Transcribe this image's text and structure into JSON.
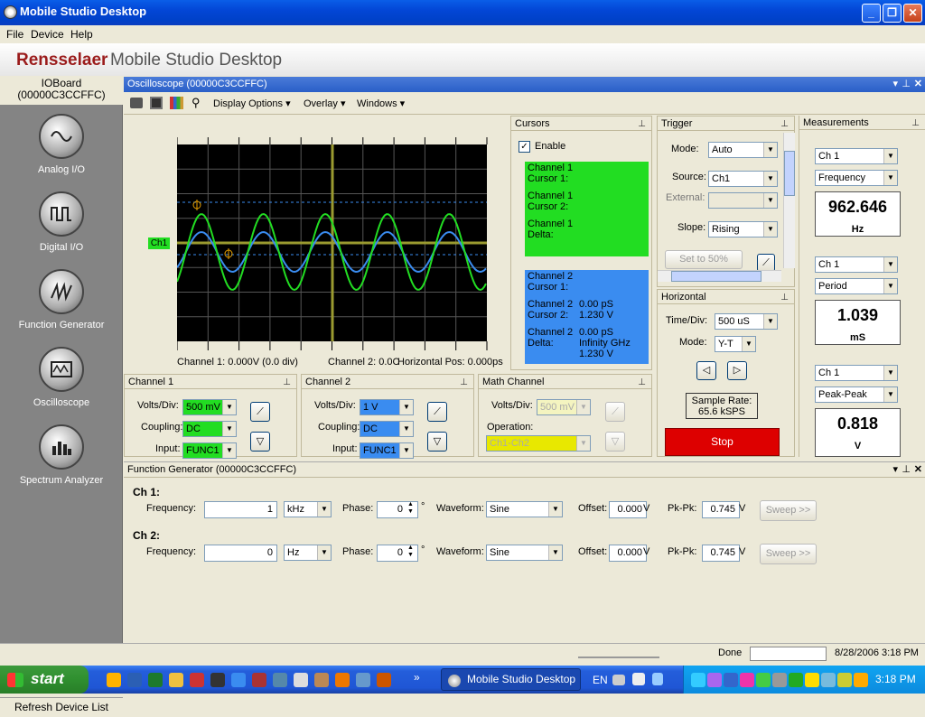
{
  "window": {
    "title": "Mobile Studio Desktop",
    "minimize": "_",
    "maximize": "❐",
    "close": "✕"
  },
  "menu": [
    "File",
    "Device",
    "Help"
  ],
  "banner": {
    "brand": "Rensselaer",
    "product": "Mobile Studio Desktop"
  },
  "sidebar": {
    "board": "IOBoard (00000C3CCFFC)",
    "items": [
      {
        "label": "Analog I/O",
        "icon": "sine-wave-icon"
      },
      {
        "label": "Digital I/O",
        "icon": "square-wave-icon"
      },
      {
        "label": "Function Generator",
        "icon": "sawtooth-icon"
      },
      {
        "label": "Oscilloscope",
        "icon": "oscilloscope-icon"
      },
      {
        "label": "Spectrum Analyzer",
        "icon": "spectrum-icon"
      }
    ],
    "refresh": "Refresh Device List"
  },
  "oscilloscope": {
    "title": "Oscilloscope (00000C3CCFFC)",
    "toolbar": [
      "Display Options",
      "Overlay",
      "Windows"
    ],
    "ch1_marker": "Ch1",
    "status_ch1": "Channel 1: 0.000V (0.0 div)",
    "status_ch2": "Channel 2: 0.0C",
    "status_hpos": "Horizontal Pos: 0.000ps",
    "cursors": {
      "title": "Cursors",
      "enable": "Enable",
      "check": "✓",
      "ch1": [
        "Channel 1",
        "Cursor 1:",
        "Channel 1",
        "Cursor 2:",
        "Channel 1",
        "Delta:"
      ],
      "ch2": {
        "c1a": "Channel 2",
        "c1b": "Cursor 1:",
        "c2a": "Channel 2",
        "c2b": "Cursor 2:",
        "c2v1": "0.00 pS",
        "c2v2": "1.230 V",
        "da": "Channel 2",
        "db": "Delta:",
        "dv1": "0.00 pS",
        "dv2": "Infinity GHz",
        "dv3": "1.230 V"
      }
    },
    "trigger": {
      "title": "Trigger",
      "mode_label": "Mode:",
      "mode": "Auto",
      "source_label": "Source:",
      "source": "Ch1",
      "external_label": "External:",
      "slope_label": "Slope:",
      "slope": "Rising",
      "set50": "Set to 50%"
    },
    "horizontal": {
      "title": "Horizontal",
      "timediv_label": "Time/Div:",
      "timediv": "500 uS",
      "mode_label": "Mode:",
      "mode": "Y-T",
      "sample_rate_label": "Sample Rate:",
      "sample_rate": "65.6 kSPS",
      "stop": "Stop"
    },
    "measurements": {
      "title": "Measurements",
      "items": [
        {
          "ch": "Ch 1",
          "type": "Frequency",
          "value": "962.646",
          "unit": "Hz"
        },
        {
          "ch": "Ch 1",
          "type": "Period",
          "value": "1.039",
          "unit": "mS"
        },
        {
          "ch": "Ch 1",
          "type": "Peak-Peak",
          "value": "0.818",
          "unit": "V"
        }
      ]
    },
    "channel1": {
      "title": "Channel 1",
      "voltsdiv_label": "Volts/Div:",
      "voltsdiv": "500 mV",
      "coupling_label": "Coupling:",
      "coupling": "DC",
      "input_label": "Input:",
      "input": "FUNC1"
    },
    "channel2": {
      "title": "Channel 2",
      "voltsdiv_label": "Volts/Div:",
      "voltsdiv": "1 V",
      "coupling_label": "Coupling:",
      "coupling": "DC",
      "input_label": "Input:",
      "input": "FUNC1"
    },
    "math": {
      "title": "Math Channel",
      "voltsdiv_label": "Volts/Div:",
      "voltsdiv": "500 mV",
      "operation_label": "Operation:",
      "operation": "Ch1-Ch2"
    }
  },
  "function_generator": {
    "title": "Function Generator (00000C3CCFFC)",
    "channels": [
      {
        "label": "Ch 1:",
        "freq_label": "Frequency:",
        "freq": "1",
        "freq_unit": "kHz",
        "phase_label": "Phase:",
        "phase": "0",
        "deg": "°",
        "waveform_label": "Waveform:",
        "waveform": "Sine",
        "offset_label": "Offset:",
        "offset": "0.000",
        "offset_unit": "V",
        "pkpk_label": "Pk-Pk:",
        "pkpk": "0.745",
        "pkpk_unit": "V",
        "sweep": "Sweep >>"
      },
      {
        "label": "Ch 2:",
        "freq_label": "Frequency:",
        "freq": "0",
        "freq_unit": "Hz",
        "phase_label": "Phase:",
        "phase": "0",
        "deg": "°",
        "waveform_label": "Waveform:",
        "waveform": "Sine",
        "offset_label": "Offset:",
        "offset": "0.000",
        "offset_unit": "V",
        "pkpk_label": "Pk-Pk:",
        "pkpk": "0.745",
        "pkpk_unit": "V",
        "sweep": "Sweep >>"
      }
    ]
  },
  "statusbar": {
    "state": "Done",
    "datetime": "8/28/2006 3:18 PM"
  },
  "taskbar": {
    "start": "start",
    "task": "Mobile Studio Desktop",
    "lang": "EN",
    "clock": "3:18 PM",
    "more": "»"
  },
  "colors": {
    "ch1": "#22dd22",
    "ch2": "#3a8cf0",
    "math": "#e8e800",
    "stop": "#dd0000"
  }
}
